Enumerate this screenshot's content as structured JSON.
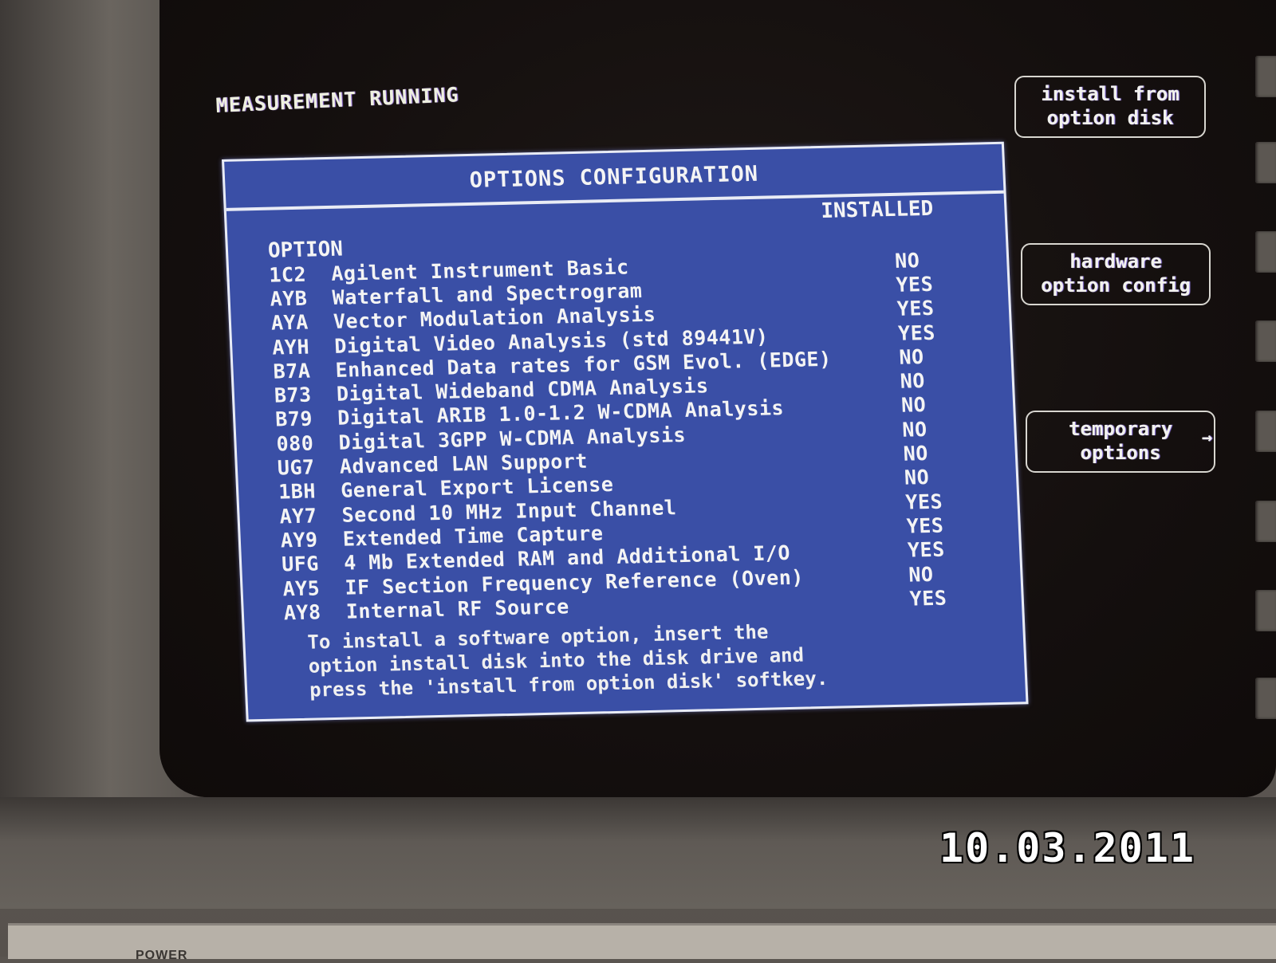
{
  "status": {
    "text": "MEASUREMENT RUNNING"
  },
  "dialog": {
    "title": "OPTIONS CONFIGURATION",
    "column_option": "OPTION",
    "column_installed": "INSTALLED",
    "rows": [
      {
        "code": "1C2",
        "description": "Agilent Instrument Basic",
        "installed": "NO"
      },
      {
        "code": "AYB",
        "description": "Waterfall and Spectrogram",
        "installed": "YES"
      },
      {
        "code": "AYA",
        "description": "Vector Modulation Analysis",
        "installed": "YES"
      },
      {
        "code": "AYH",
        "description": "Digital Video Analysis (std 89441V)",
        "installed": "YES"
      },
      {
        "code": "B7A",
        "description": "Enhanced Data rates for GSM Evol. (EDGE)",
        "installed": "NO"
      },
      {
        "code": "B73",
        "description": "Digital Wideband CDMA Analysis",
        "installed": "NO"
      },
      {
        "code": "B79",
        "description": "Digital ARIB 1.0-1.2 W-CDMA Analysis",
        "installed": "NO"
      },
      {
        "code": "080",
        "description": "Digital 3GPP W-CDMA Analysis",
        "installed": "NO"
      },
      {
        "code": "UG7",
        "description": "Advanced LAN Support",
        "installed": "NO"
      },
      {
        "code": "1BH",
        "description": "General Export License",
        "installed": "NO"
      },
      {
        "code": "AY7",
        "description": "Second 10 MHz Input Channel",
        "installed": "YES"
      },
      {
        "code": "AY9",
        "description": "Extended Time Capture",
        "installed": "YES"
      },
      {
        "code": "UFG",
        "description": "4 Mb Extended RAM and Additional I/O",
        "installed": "YES"
      },
      {
        "code": "AY5",
        "description": "IF Section Frequency Reference (Oven)",
        "installed": "NO"
      },
      {
        "code": "AY8",
        "description": "Internal RF Source",
        "installed": "YES"
      }
    ],
    "note_lines": [
      "To install a software option, insert the",
      "option install disk into the disk drive and",
      "press the 'install from option disk' softkey."
    ]
  },
  "softkeys": [
    {
      "line1": "install from",
      "line2": "option disk",
      "icon": null
    },
    {
      "line1": "hardware",
      "line2": "option config",
      "icon": null
    },
    {
      "line1": "temporary",
      "line2": "options",
      "icon": "arrow-right-icon"
    }
  ],
  "softkey_arrow_glyph": "→",
  "panel": {
    "label": "POWER"
  },
  "date_stamp": "10.03.2011"
}
